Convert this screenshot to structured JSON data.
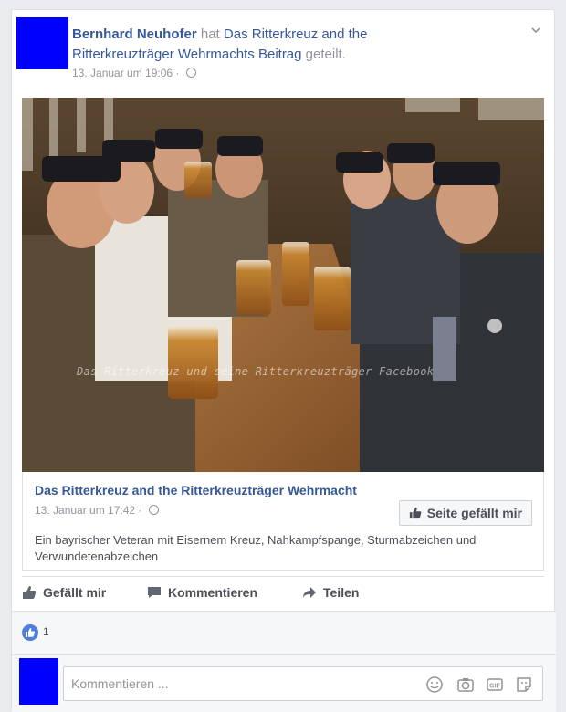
{
  "post": {
    "author": "Bernhard Neuhofer",
    "action_word": "hat",
    "page_name": "Das Ritterkreuz and the Ritterkreuzträger Wehrmacht",
    "page_suffix": "s",
    "post_word": "Beitrag",
    "shared_word": "geteilt.",
    "timestamp": "13. Januar um 19:06",
    "separator": "·"
  },
  "photo": {
    "watermark": "Das Ritterkreuz und seine Ritterkreuzträger Facebook"
  },
  "shared": {
    "title": "Das Ritterkreuz and the Ritterkreuzträger Wehrmacht",
    "timestamp": "13. Januar um 17:42",
    "separator": "·",
    "like_page_label": "Seite gefällt mir",
    "description": "Ein bayrischer Veteran mit Eisernem Kreuz, Nahkampfspange, Sturmabzeichen und Verwundetenabzeichen"
  },
  "actions": {
    "like": "Gefällt mir",
    "comment": "Kommentieren",
    "share": "Teilen"
  },
  "reactions": {
    "count": "1"
  },
  "comment": {
    "placeholder": "Kommentieren ..."
  },
  "icons": {
    "header_menu": "chevron-down-icon",
    "audience": "globe-icon",
    "like": "thumbs-up-icon",
    "comment": "speech-bubble-icon",
    "share": "share-arrow-icon",
    "emoji": "emoji-icon",
    "camera": "camera-icon",
    "gif": "gif-icon",
    "sticker": "sticker-icon"
  },
  "colors": {
    "link": "#365899",
    "avatar": "#0000ff",
    "like_blue": "#4f7ed8",
    "page_bg": "#e9ebee"
  }
}
